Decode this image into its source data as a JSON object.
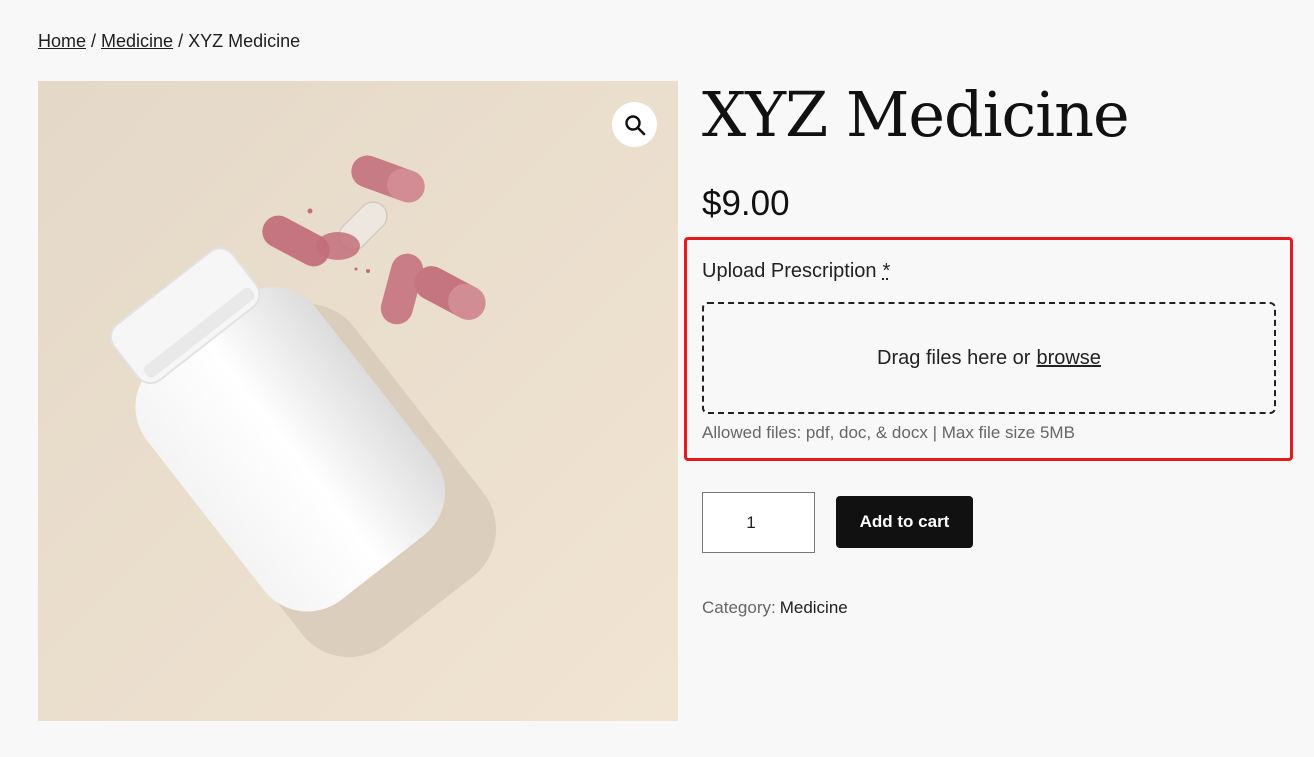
{
  "breadcrumb": {
    "home": "Home",
    "separator": "/",
    "category": "Medicine",
    "current": "XYZ Medicine"
  },
  "product": {
    "title": "XYZ Medicine",
    "price": "$9.00",
    "image_icon": "zoom-icon"
  },
  "upload": {
    "label": "Upload Prescription",
    "required_mark": "*",
    "drop_text": "Drag files here or",
    "browse_link": "browse",
    "hint": "Allowed files: pdf, doc, & docx | Max file size 5MB",
    "highlight_color": "#e31b1b"
  },
  "cart": {
    "quantity": "1",
    "button_label": "Add to cart"
  },
  "meta": {
    "category_label": "Category:",
    "category_value": "Medicine"
  },
  "colors": {
    "page_bg": "#f8f8f8",
    "button_bg": "#111111",
    "image_bg": "#e6dccd"
  }
}
